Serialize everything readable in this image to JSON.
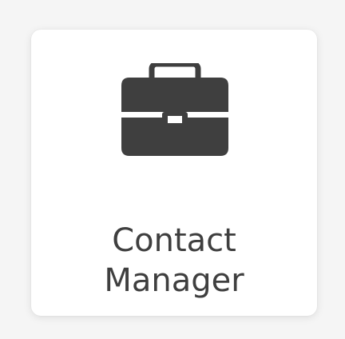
{
  "app_tile": {
    "icon": "briefcase-icon",
    "label_line1": "Contact",
    "label_line2": "Manager",
    "icon_color": "#3f3f3f",
    "background_color": "#ffffff"
  }
}
